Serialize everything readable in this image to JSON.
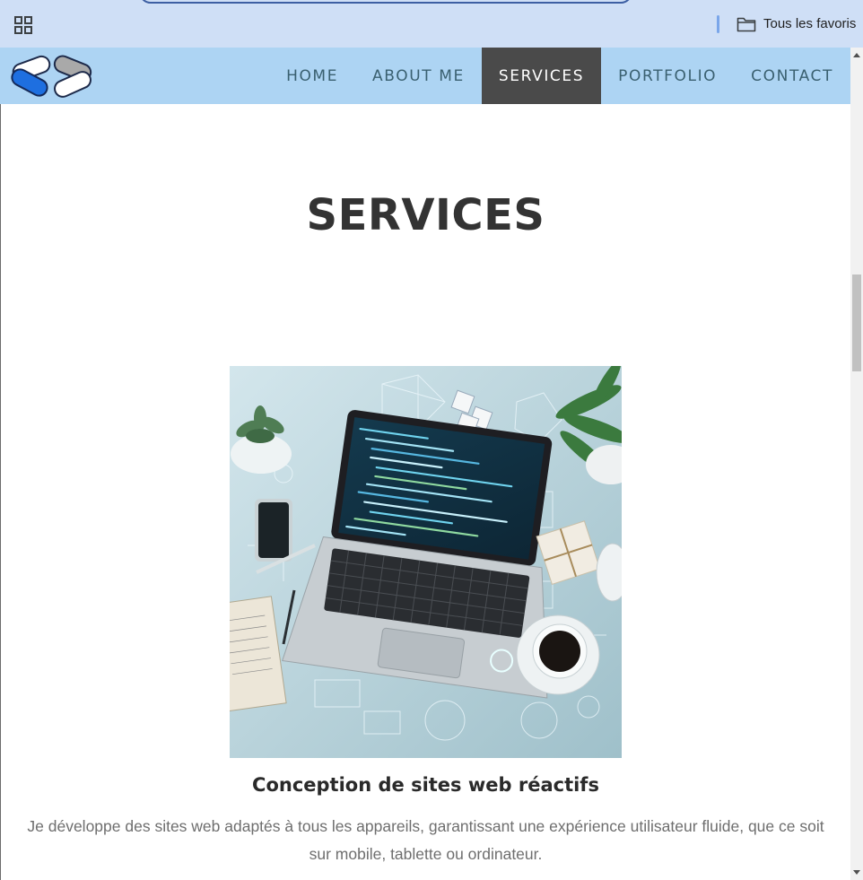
{
  "browser": {
    "bookmarks_folder_label": "Tous les favoris",
    "apps_icon": "apps-grid-icon",
    "folder_icon": "folder-icon"
  },
  "site": {
    "logo": "logo-icon",
    "nav": [
      {
        "label": "HOME",
        "active": false
      },
      {
        "label": "ABOUT ME",
        "active": false
      },
      {
        "label": "SERVICES",
        "active": true
      },
      {
        "label": "PORTFOLIO",
        "active": false
      },
      {
        "label": "CONTACT",
        "active": false
      }
    ],
    "colors": {
      "header_bg": "#add4f3",
      "nav_active_bg": "#4a4a4a",
      "nav_text": "#3a6070"
    }
  },
  "main": {
    "section_title": "SERVICES",
    "service": {
      "title": "Conception de sites web réactifs",
      "description": "Je développe des sites web adaptés à tous les appareils, garantissant une expérience utilisateur fluide, que ce soit sur mobile, tablette ou ordinateur."
    }
  }
}
